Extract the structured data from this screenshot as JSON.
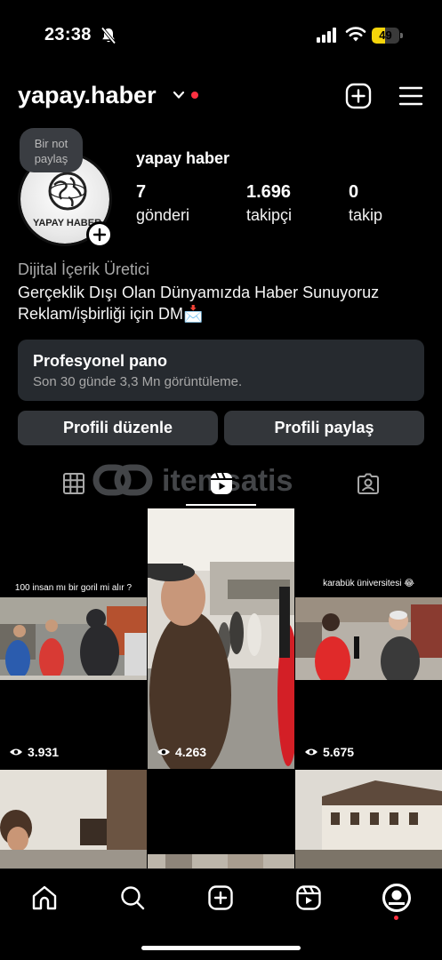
{
  "status_bar": {
    "time": "23:38",
    "battery": "49",
    "battery_level": 0.49
  },
  "header": {
    "username": "yapay.haber"
  },
  "profile": {
    "note": "Bir not paylaş",
    "avatar_text": "YAPAY HABER",
    "display_name": "yapay haber",
    "stats": [
      {
        "value": "7",
        "label": "gönderi"
      },
      {
        "value": "1.696",
        "label": "takipçi"
      },
      {
        "value": "0",
        "label": "takip"
      }
    ],
    "category": "Dijital İçerik Üretici",
    "bio_line1": "Gerçeklik Dışı Olan Dünyamızda Haber Sunuyoruz",
    "bio_line2": "Reklam/işbirliği için DM📩"
  },
  "pro_panel": {
    "title": "Profesyonel pano",
    "subtitle": "Son 30 günde 3,3 Mn görüntüleme."
  },
  "buttons": {
    "edit": "Profili düzenle",
    "share": "Profili paylaş"
  },
  "watermark": "itemsatis",
  "posts": [
    {
      "caption": "100 insan mı bir goril mi alır ?",
      "views": "3.931"
    },
    {
      "caption": "",
      "views": "4.263"
    },
    {
      "caption": "karabük üniversitesi 😂",
      "views": "5.675"
    },
    {
      "caption": "",
      "views": ""
    },
    {
      "caption": "",
      "views": ""
    },
    {
      "caption": "",
      "views": ""
    }
  ],
  "nav": [
    "home-icon",
    "search-icon",
    "create-icon",
    "reels-icon",
    "profile-avatar"
  ],
  "colors": {
    "accent_red": "#ff3040",
    "panel": "#262a2f",
    "button": "#33363a",
    "battery": "#f5d40a"
  }
}
